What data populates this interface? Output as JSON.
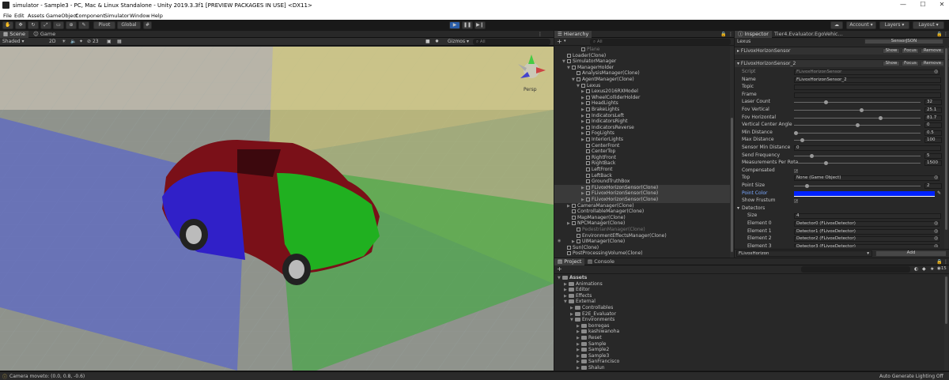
{
  "window": {
    "title": "simulator - Sample3 - PC, Mac & Linux Standalone - Unity 2019.3.3f1 [PREVIEW PACKAGES IN USE] <DX11>",
    "minimize": "—",
    "maximize": "☐",
    "close": "✕"
  },
  "menu": [
    "File",
    "Edit",
    "Assets",
    "GameObject",
    "Component",
    "Simulator",
    "Window",
    "Help"
  ],
  "toolbar": {
    "pivot": "Pivot",
    "global": "Global",
    "play": "▶",
    "pause": "❚❚",
    "step": "▶❙",
    "account": "Account",
    "layers": "Layers",
    "layout": "Layout"
  },
  "scene": {
    "tabs": [
      "Scene",
      "Game"
    ],
    "shading": "Shaded",
    "mode2d": "2D",
    "gizmos": "Gizmos",
    "search": "All",
    "persp": "Persp",
    "audio_count": "23"
  },
  "colors": {
    "sky": "#c9c3b8",
    "ground": "#8a8e86",
    "blue_plane": "#4a5ad8",
    "green_plane": "#3caa3c",
    "yellow_plane": "#d8d070",
    "car_red": "#7a1018",
    "car_blue": "#3020c8",
    "car_green": "#20b020",
    "point_color": "#0022ff"
  },
  "hierarchy": {
    "tab": "Hierarchy",
    "create": "+",
    "search": "All",
    "items": [
      {
        "label": "Plane",
        "depth": 4,
        "arrow": "",
        "dim": true
      },
      {
        "label": "Loader(Clone)",
        "depth": 1,
        "arrow": ""
      },
      {
        "label": "SimulatorManager",
        "depth": 1,
        "arrow": "▼"
      },
      {
        "label": "ManagerHolder",
        "depth": 2,
        "arrow": "▼"
      },
      {
        "label": "AnalysisManager(Clone)",
        "depth": 3,
        "arrow": ""
      },
      {
        "label": "AgentManager(Clone)",
        "depth": 3,
        "arrow": "▼"
      },
      {
        "label": "Lexus",
        "depth": 4,
        "arrow": "▼"
      },
      {
        "label": "Lexus2016RXModel",
        "depth": 5,
        "arrow": "▶"
      },
      {
        "label": "WheelColliderHolder",
        "depth": 5,
        "arrow": "▶"
      },
      {
        "label": "HeadLights",
        "depth": 5,
        "arrow": "▶"
      },
      {
        "label": "BrakeLights",
        "depth": 5,
        "arrow": "▶"
      },
      {
        "label": "IndicatorsLeft",
        "depth": 5,
        "arrow": "▶"
      },
      {
        "label": "IndicatorsRight",
        "depth": 5,
        "arrow": "▶"
      },
      {
        "label": "IndicatorsReverse",
        "depth": 5,
        "arrow": "▶"
      },
      {
        "label": "FogLights",
        "depth": 5,
        "arrow": "▶"
      },
      {
        "label": "InteriorLights",
        "depth": 5,
        "arrow": "▶"
      },
      {
        "label": "CenterFront",
        "depth": 5,
        "arrow": ""
      },
      {
        "label": "CenterTop",
        "depth": 5,
        "arrow": ""
      },
      {
        "label": "RightFront",
        "depth": 5,
        "arrow": ""
      },
      {
        "label": "RightBack",
        "depth": 5,
        "arrow": ""
      },
      {
        "label": "LeftFront",
        "depth": 5,
        "arrow": ""
      },
      {
        "label": "LeftBack",
        "depth": 5,
        "arrow": ""
      },
      {
        "label": "GroundTruthBox",
        "depth": 5,
        "arrow": ""
      },
      {
        "label": "FLivoxHorizonSensor(Clone)",
        "depth": 5,
        "arrow": "▶",
        "sel": true
      },
      {
        "label": "FLivoxHorizonSensor(Clone)",
        "depth": 5,
        "arrow": "▶",
        "sel": true
      },
      {
        "label": "FLivoxHorizonSensor(Clone)",
        "depth": 5,
        "arrow": "▶",
        "sel": true
      },
      {
        "label": "CameraManager(Clone)",
        "depth": 2,
        "arrow": "▶"
      },
      {
        "label": "ControllableManager(Clone)",
        "depth": 2,
        "arrow": ""
      },
      {
        "label": "MapManager(Clone)",
        "depth": 2,
        "arrow": ""
      },
      {
        "label": "NPCManager(Clone)",
        "depth": 2,
        "arrow": "▶"
      },
      {
        "label": "PedestrianManager(Clone)",
        "depth": 3,
        "arrow": "",
        "dim": true
      },
      {
        "label": "EnvironmentEffectsManager(Clone)",
        "depth": 3,
        "arrow": ""
      },
      {
        "label": "UIManager(Clone)",
        "depth": 3,
        "arrow": "▶"
      },
      {
        "label": "Sun(Clone)",
        "depth": 1,
        "arrow": ""
      },
      {
        "label": "PostProcessingVolume(Clone)",
        "depth": 1,
        "arrow": ""
      }
    ]
  },
  "inspector": {
    "tabs": [
      "Inspector",
      "Tier4.Evaluator.EgoVehic..."
    ],
    "object": "Lexus",
    "sensor_btn": "SensorJSON",
    "comp1": {
      "name": "FLivoxHorizonSensor",
      "show": "Show",
      "focus": "Focus",
      "remove": "Remove"
    },
    "comp2": {
      "name": "FLivoxHorizonSensor_2",
      "show": "Show",
      "focus": "Focus",
      "remove": "Remove"
    },
    "fields": [
      {
        "label": "Script",
        "type": "obj",
        "value": "FLivoxHorizonSensor",
        "dim": true
      },
      {
        "label": "Name",
        "type": "text",
        "value": "FLivoxHorizonSensor_2"
      },
      {
        "label": "Topic",
        "type": "text",
        "value": ""
      },
      {
        "label": "Frame",
        "type": "text",
        "value": ""
      },
      {
        "label": "Laser Count",
        "type": "slider",
        "value": "32",
        "frac": 0.25
      },
      {
        "label": "Fov Vertical",
        "type": "slider",
        "value": "25.1",
        "frac": 0.53
      },
      {
        "label": "Fov Horizontal",
        "type": "slider",
        "value": "81.7",
        "frac": 0.68
      },
      {
        "label": "Vertical Center Angle",
        "type": "slider",
        "value": "0",
        "frac": 0.5
      },
      {
        "label": "Min Distance",
        "type": "slider",
        "value": "0.5",
        "frac": 0.01
      },
      {
        "label": "Max Distance",
        "type": "slider",
        "value": "100",
        "frac": 0.06
      },
      {
        "label": "Sensor Min Distance",
        "type": "text",
        "value": "0"
      },
      {
        "label": "Send Frequency",
        "type": "slider",
        "value": "5",
        "frac": 0.14
      },
      {
        "label": "Measurements Per Rota",
        "type": "slider",
        "value": "1500",
        "frac": 0.25
      },
      {
        "label": "Compensated",
        "type": "check",
        "value": "✓"
      },
      {
        "label": "Top",
        "type": "obj",
        "value": "None (Game Object)"
      },
      {
        "label": "Point Size",
        "type": "slider",
        "value": "2",
        "frac": 0.1
      },
      {
        "label": "Point Color",
        "type": "color",
        "value": "",
        "blue": true
      },
      {
        "label": "Show Frustum",
        "type": "check",
        "value": "✓"
      },
      {
        "label": "Detectors",
        "type": "fold",
        "value": ""
      },
      {
        "label": "Size",
        "type": "text",
        "value": "4",
        "indent": true
      },
      {
        "label": "Element 0",
        "type": "obj",
        "value": "Detector0 (FLivoxDetector)",
        "indent": true
      },
      {
        "label": "Element 1",
        "type": "obj",
        "value": "Detector1 (FLivoxDetector)",
        "indent": true
      },
      {
        "label": "Element 2",
        "type": "obj",
        "value": "Detector2 (FLivoxDetector)",
        "indent": true
      },
      {
        "label": "Element 3",
        "type": "obj",
        "value": "Detector3 (FLivoxDetector)",
        "indent": true
      }
    ],
    "add_select": "FLivoxHorizon",
    "add_btn": "Add"
  },
  "project": {
    "tabs": [
      "Project",
      "Console"
    ],
    "create": "+",
    "count": "15",
    "tree": [
      {
        "label": "Assets",
        "depth": 0,
        "arrow": "▼",
        "bold": true
      },
      {
        "label": "Animations",
        "depth": 1,
        "arrow": "▶"
      },
      {
        "label": "Editor",
        "depth": 1,
        "arrow": "▶"
      },
      {
        "label": "Effects",
        "depth": 1,
        "arrow": "▶"
      },
      {
        "label": "External",
        "depth": 1,
        "arrow": "▼"
      },
      {
        "label": "Controllables",
        "depth": 2,
        "arrow": "▶"
      },
      {
        "label": "E2E_Evaluator",
        "depth": 2,
        "arrow": "▶"
      },
      {
        "label": "Environments",
        "depth": 2,
        "arrow": "▼"
      },
      {
        "label": "borregas",
        "depth": 3,
        "arrow": "▶"
      },
      {
        "label": "kashiwanoha",
        "depth": 3,
        "arrow": "▶"
      },
      {
        "label": "Reset",
        "depth": 3,
        "arrow": "▶"
      },
      {
        "label": "Sample",
        "depth": 3,
        "arrow": "▶"
      },
      {
        "label": "Sample2",
        "depth": 3,
        "arrow": "▶"
      },
      {
        "label": "Sample3",
        "depth": 3,
        "arrow": "▶"
      },
      {
        "label": "SanFrancisco",
        "depth": 3,
        "arrow": "▶"
      },
      {
        "label": "Shalun",
        "depth": 3,
        "arrow": "▶"
      }
    ]
  },
  "status": {
    "left": "Camera moveto: (0.0, 0.8, -0.6)",
    "right": "Auto Generate Lighting Off"
  }
}
